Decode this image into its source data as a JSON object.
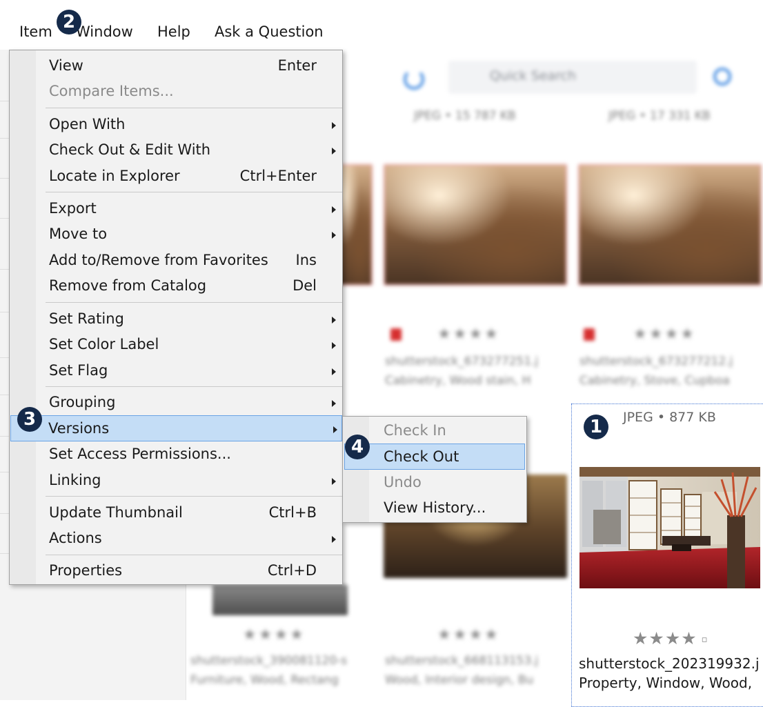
{
  "menubar": {
    "items": [
      {
        "label": "Item"
      },
      {
        "label": "Window"
      },
      {
        "label": "Help"
      },
      {
        "label": "Ask a Question"
      }
    ]
  },
  "menu": {
    "items": [
      {
        "label": "View",
        "shortcut": "Enter"
      },
      {
        "label": "Compare Items...",
        "disabled": true
      },
      {
        "label": "Open With",
        "submenu": true
      },
      {
        "label": "Check Out & Edit With",
        "submenu": true
      },
      {
        "label": "Locate in Explorer",
        "shortcut": "Ctrl+Enter"
      },
      {
        "label": "Export",
        "submenu": true
      },
      {
        "label": "Move to",
        "submenu": true
      },
      {
        "label": "Add to/Remove from Favorites",
        "shortcut": "Ins"
      },
      {
        "label": "Remove from Catalog",
        "shortcut": "Del"
      },
      {
        "label": "Set Rating",
        "submenu": true
      },
      {
        "label": "Set Color Label",
        "submenu": true
      },
      {
        "label": "Set Flag",
        "submenu": true
      },
      {
        "label": "Grouping",
        "submenu": true
      },
      {
        "label": "Versions",
        "submenu": true,
        "highlighted": true
      },
      {
        "label": "Set Access Permissions..."
      },
      {
        "label": "Linking",
        "submenu": true
      },
      {
        "label": "Update Thumbnail",
        "shortcut": "Ctrl+B"
      },
      {
        "label": "Actions",
        "submenu": true
      },
      {
        "label": "Properties",
        "shortcut": "Ctrl+D"
      }
    ]
  },
  "submenu": {
    "items": [
      {
        "label": "Check In",
        "disabled": true
      },
      {
        "label": "Check Out",
        "highlighted": true
      },
      {
        "label": "Undo",
        "disabled": true
      },
      {
        "label": "View History..."
      }
    ]
  },
  "badges": {
    "one": "1",
    "two": "2",
    "three": "3",
    "four": "4"
  },
  "card": {
    "meta": "JPEG • 877 KB",
    "stars": "★★★★",
    "stars_mark": "▫",
    "filename": "shutterstock_202319932.j",
    "tags": "Property, Window, Wood,"
  },
  "background": {
    "search_placeholder": "Quick Search",
    "sizes": [
      "JPEG • 15 787 KB",
      "JPEG • 17 331 KB"
    ],
    "stars": "★★★★",
    "filenames": [
      "shutterstock_673277251.j",
      "shutterstock_673277212.j",
      "shutterstock_390081120-s",
      "shutterstock_668113153.j"
    ],
    "tags": [
      "Cabinetry, Wood stain, H",
      "Cabinetry, Stove, Cupboa",
      "Furniture, Wood, Rectang",
      "Wood, Interior design, Bu"
    ]
  },
  "colors": {
    "menu_bg": "#f2f2f2",
    "highlight": "#c4ddf6",
    "highlight_border": "#6aa3e4",
    "badge": "#152a4a",
    "accent": "#4a90e2",
    "flag": "#d62f2f"
  }
}
